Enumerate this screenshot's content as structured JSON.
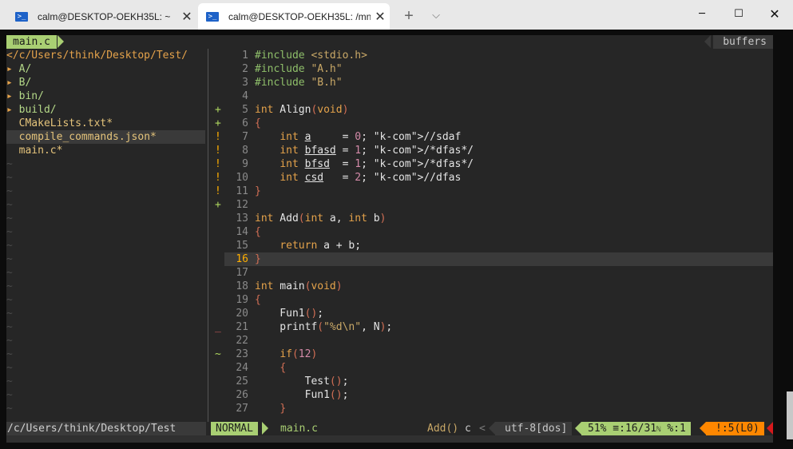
{
  "tabs": [
    {
      "icon": "powershell-icon",
      "title": "calm@DESKTOP-OEKH35L: ~",
      "close": "✕"
    },
    {
      "icon": "powershell-icon",
      "title": "calm@DESKTOP-OEKH35L: /mn",
      "close": "✕"
    }
  ],
  "titlebar": {
    "new_tab": "+",
    "dropdown": "⌵",
    "minimize": "─",
    "maximize": "☐",
    "close": "✕"
  },
  "tabline": {
    "file": "main.c",
    "buffers": "buffers"
  },
  "tree": {
    "root": "</c/Users/think/Desktop/Test/",
    "entries": [
      {
        "marker": "▸ ",
        "name": "A/"
      },
      {
        "marker": "▸ ",
        "name": "B/"
      },
      {
        "marker": "▸ ",
        "name": "bin/"
      },
      {
        "marker": "▸ ",
        "name": "build/"
      },
      {
        "marker": "  ",
        "name": "CMakeLists.txt*"
      },
      {
        "marker": "  ",
        "name": "compile_commands.json*"
      },
      {
        "marker": "  ",
        "name": "main.c*"
      }
    ],
    "tilde": "~"
  },
  "signs": {
    "5": "+",
    "6": "+",
    "7": "!",
    "8": "!",
    "9": "!",
    "10": "!",
    "11": "!",
    "12": "+",
    "21": "_",
    "23": "~"
  },
  "code_lines": [
    {
      "n": "1",
      "t": "#include <stdio.h>"
    },
    {
      "n": "2",
      "t": "#include \"A.h\""
    },
    {
      "n": "3",
      "t": "#include \"B.h\""
    },
    {
      "n": "4",
      "t": ""
    },
    {
      "n": "5",
      "t": "int Align(void)"
    },
    {
      "n": "6",
      "t": "{"
    },
    {
      "n": "7",
      "t": "    int a     = 0; //sdaf"
    },
    {
      "n": "8",
      "t": "    int bfasd = 1; /*dfas*/"
    },
    {
      "n": "9",
      "t": "    int bfsd  = 1; /*dfas*/"
    },
    {
      "n": "10",
      "t": "    int csd   = 2; //dfas"
    },
    {
      "n": "11",
      "t": "}"
    },
    {
      "n": "12",
      "t": ""
    },
    {
      "n": "13",
      "t": "int Add(int a, int b)"
    },
    {
      "n": "14",
      "t": "{"
    },
    {
      "n": "15",
      "t": "    return a + b;"
    },
    {
      "n": "16",
      "t": "}"
    },
    {
      "n": "17",
      "t": ""
    },
    {
      "n": "18",
      "t": "int main(void)"
    },
    {
      "n": "19",
      "t": "{"
    },
    {
      "n": "20",
      "t": "    Fun1();"
    },
    {
      "n": "21",
      "t": "    printf(\"%d\\n\", N);"
    },
    {
      "n": "22",
      "t": ""
    },
    {
      "n": "23",
      "t": "    if(12)"
    },
    {
      "n": "24",
      "t": "    {"
    },
    {
      "n": "25",
      "t": "        Test();"
    },
    {
      "n": "26",
      "t": "        Fun1();"
    },
    {
      "n": "27",
      "t": "    }"
    }
  ],
  "current_line": "16",
  "status": {
    "path": "/c/Users/think/Desktop/Test",
    "mode": "NORMAL",
    "file": "main.c",
    "function": "Add()",
    "filetype": "c",
    "filetype_sep": "<",
    "encoding": "utf-8[dos]",
    "position": "51% ≡:16/31",
    "position_suffix": "ℕ",
    "column": "%:1",
    "warnings": "!:5(L0)"
  },
  "colors": {
    "accent": "#a9cf73",
    "warning": "#ff8700",
    "error": "#d7191c",
    "tree_accent": "#e5a34b"
  }
}
